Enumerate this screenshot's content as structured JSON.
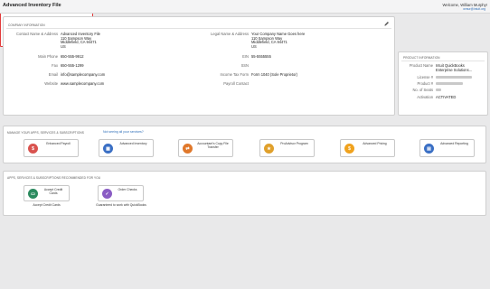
{
  "page": {
    "title": "Advanced Inventory File"
  },
  "account_box": {
    "welcome": "Welcome, William Murphy!",
    "email": "wmur@intuit.org",
    "manage_button": "Manage Your Account",
    "links": [
      "Order/Payment History",
      "Authorized Users",
      "Payment Methods",
      "Account Details"
    ]
  },
  "company": {
    "section_title": "COMPANY INFORMATION",
    "name_address_label": "Contact Name & Address",
    "name_address_lines": [
      "Advanced Inventory File",
      "110 Sampson Way",
      "Middlefield, CA 94471",
      "US"
    ],
    "main_phone_label": "Main Phone",
    "main_phone": "650-555-9912",
    "fax_label": "Fax",
    "fax": "650-555-1299",
    "email_label": "Email",
    "email": "info@samplecompany.com",
    "website_label": "Website",
    "website": "www.samplecompany.com",
    "legal_label": "Legal Name & Address",
    "legal_lines": [
      "Your Company Name Goes here",
      "110 Sampson Way",
      "Middlefield, CA 94471",
      "US"
    ],
    "ein_label": "EIN",
    "ein": "55-5555555",
    "ssn_label": "SSN",
    "ssn": "",
    "tax_form_label": "Income Tax Form",
    "tax_form": "Form 1040 (Sole Proprietor)",
    "payroll_label": "Payroll Contact",
    "payroll": ""
  },
  "product": {
    "section_title": "PRODUCT INFORMATION",
    "name_label": "Product Name",
    "name_lines": [
      "Intuit QuickBooks",
      "Enterprise Solutions..."
    ],
    "license_label": "License #",
    "product_label": "Product #",
    "seats_label": "No. of Seats",
    "activation_label": "Activation",
    "activation": "ACTIVATED"
  },
  "apps": {
    "section_title": "MANAGE YOUR APPS, SERVICES & SUBSCRIPTIONS",
    "not_seeing_link": "Not seeing all your services?",
    "tiles": [
      {
        "label": "Enhanced Payroll",
        "icon": "payroll-icon",
        "color": "#d9534f"
      },
      {
        "label": "Advanced Inventory",
        "icon": "inventory-icon",
        "color": "#3a6fc4"
      },
      {
        "label": "Accountant's Copy File Transfer",
        "icon": "file-transfer-icon",
        "color": "#e0782b"
      },
      {
        "label": "ProAdvisor Program",
        "icon": "proadvisor-icon",
        "color": "#e0a02b"
      },
      {
        "label": "Advanced Pricing",
        "icon": "pricing-icon",
        "color": "#f0a21e"
      },
      {
        "label": "Advanced Reporting",
        "icon": "reporting-icon",
        "color": "#3a6fc4"
      }
    ]
  },
  "recommended": {
    "section_title": "APPS, SERVICES & SUBSCRIPTIONS RECOMMENDED FOR YOU",
    "tiles": [
      {
        "label": "Accept Credit Cards",
        "caption": "Accept Credit Cards",
        "icon": "credit-card-icon",
        "color": "#2b8a5e"
      },
      {
        "label": "Order Checks",
        "caption": "Guaranteed to work with QuickBooks",
        "icon": "checks-icon",
        "color": "#8a5cc4"
      }
    ]
  }
}
